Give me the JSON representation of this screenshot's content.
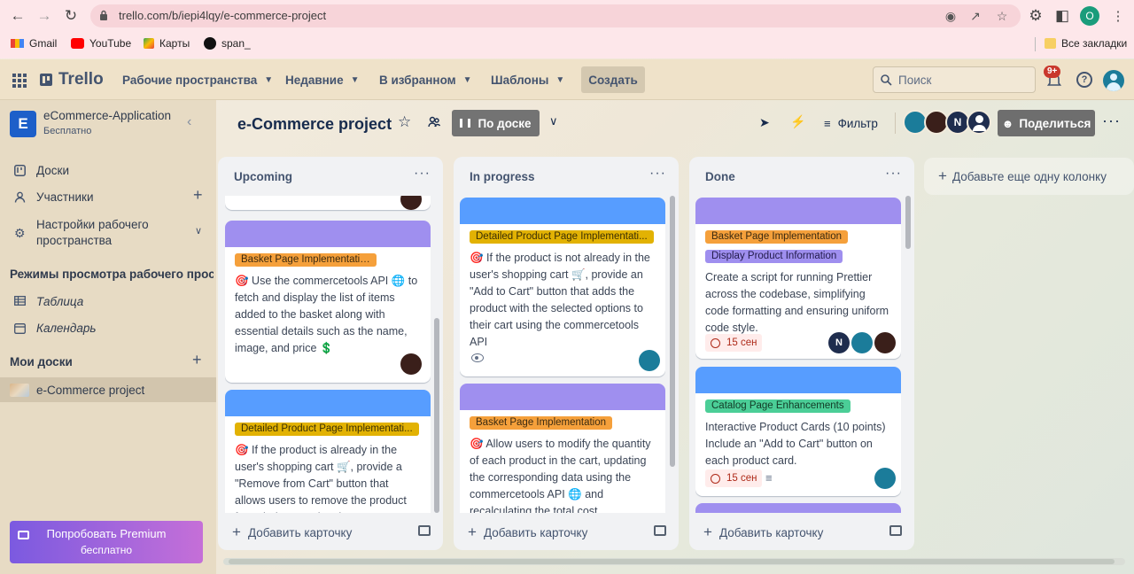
{
  "browser": {
    "url": "trello.com/b/iepi4lqy/e-commerce-project",
    "profile_initial": "O",
    "bookmarks": [
      {
        "label": "Gmail"
      },
      {
        "label": "YouTube"
      },
      {
        "label": "Карты"
      },
      {
        "label": "span_"
      }
    ],
    "all_bookmarks": "Все закладки"
  },
  "header": {
    "logo": "Trello",
    "nav": [
      "Рабочие пространства",
      "Недавние",
      "В избранном",
      "Шаблоны"
    ],
    "create": "Создать",
    "search_placeholder": "Поиск",
    "notif_badge": "9+"
  },
  "sidebar": {
    "workspace_initial": "E",
    "workspace_name": "eCommerce-Application",
    "workspace_plan": "Бесплатно",
    "items": [
      {
        "label": "Доски"
      },
      {
        "label": "Участники"
      },
      {
        "label": "Настройки рабочего пространства"
      }
    ],
    "views_title": "Режимы просмотра рабочего прос...",
    "views": [
      {
        "label": "Таблица"
      },
      {
        "label": "Календарь"
      }
    ],
    "my_boards_title": "Мои доски",
    "boards": [
      {
        "label": "e-Commerce project"
      }
    ],
    "premium_line1": "Попробовать Premium",
    "premium_line2": "бесплатно"
  },
  "board": {
    "title": "e-Commerce project",
    "view": "По доске",
    "filter": "Фильтр",
    "share": "Поделиться",
    "member_initial": "N",
    "add_column": "Добавьте еще одну колонку",
    "add_card": "Добавить карточку"
  },
  "columns": [
    {
      "title": "Upcoming",
      "cards": [
        {
          "label": "Basket Page Implementation",
          "text": "🎯 Use the commercetools API 🌐 to fetch and display the list of items added to the basket along with essential details such as the name, image, and price 💲"
        },
        {
          "label": "Detailed Product Page Implementati...",
          "text": "🎯 If the product is already in the user's shopping cart 🛒, provide a \"Remove from Cart\" button that allows users to remove the product from their cart using the"
        }
      ]
    },
    {
      "title": "In progress",
      "cards": [
        {
          "label": "Detailed Product Page Implementati...",
          "text": "🎯 If the product is not already in the user's shopping cart 🛒, provide an \"Add to Cart\" button that adds the product with the selected options to their cart using the commercetools API"
        },
        {
          "label": "Basket Page Implementation",
          "text": "🎯 Allow users to modify the quantity of each product in the cart, updating the corresponding data using the commercetools API 🌐 and recalculating the total cost"
        }
      ]
    },
    {
      "title": "Done",
      "cards": [
        {
          "label": "Basket Page Implementation",
          "label2": "Display Product Information",
          "text": "Create a script for running Prettier across the codebase, simplifying code formatting and ensuring uniform code style.",
          "date": "15 сен"
        },
        {
          "label": "Catalog Page Enhancements",
          "text": "Interactive Product Cards (10 points) Include an \"Add to Cart\" button on each product card.",
          "date": "15 сен"
        }
      ]
    }
  ],
  "colors": {
    "purple_cover": "#9f8fef",
    "blue_cover": "#579dff",
    "label_orange": "#f5a03b",
    "label_yellow": "#e2b203",
    "label_green": "#4bce97",
    "workspace_blue": "#1d5fc9"
  }
}
